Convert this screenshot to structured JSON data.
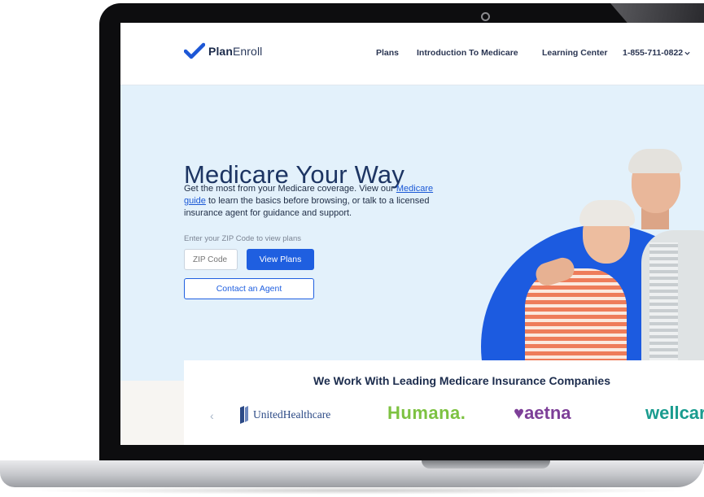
{
  "header": {
    "logo_plan": "Plan",
    "logo_enroll": "Enroll",
    "nav": {
      "plans": "Plans",
      "intro": "Introduction To Medicare",
      "learning": "Learning Center",
      "phone": "1-855-711-0822"
    }
  },
  "hero": {
    "title": "Medicare Your Way",
    "desc_before": "Get the most from your Medicare coverage. View our ",
    "desc_link": "Medicare guide",
    "desc_after": " to learn the basics before browsing, or talk to a licensed insurance agent for guidance and support.",
    "zip_label": "Enter your ZIP Code to view plans",
    "zip_placeholder": "ZIP Code",
    "view_plans": "View Plans",
    "contact_agent": "Contact an Agent"
  },
  "partners": {
    "title": "We Work With Leading Medicare Insurance Companies",
    "prev_arrow": "‹",
    "logos": [
      "UnitedHealthcare",
      "Humana.",
      "aetna",
      "wellcar"
    ]
  },
  "colors": {
    "brand_blue": "#1f5fe0",
    "navy": "#1d3563",
    "hero_bg": "#e3f1fb",
    "humana_green": "#7dc241",
    "aetna_purple": "#7d3f98",
    "wellcare_teal": "#1a9c8f"
  }
}
